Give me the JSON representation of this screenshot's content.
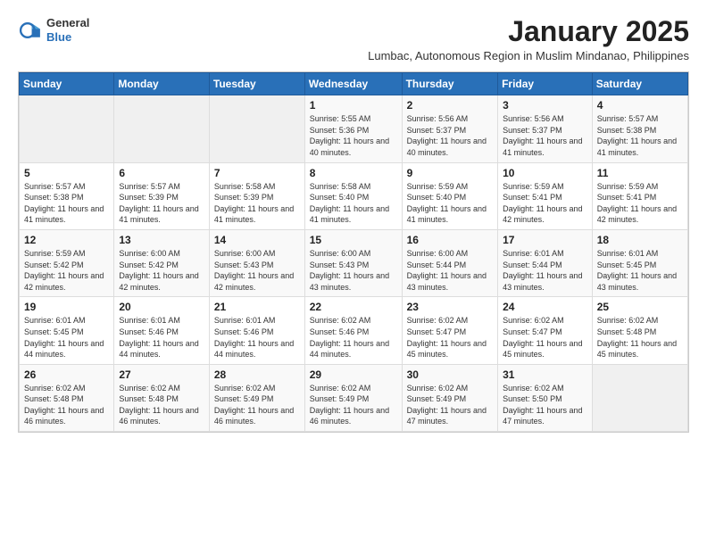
{
  "logo": {
    "line1": "General",
    "line2": "Blue"
  },
  "title": "January 2025",
  "subtitle": "Lumbac, Autonomous Region in Muslim Mindanao, Philippines",
  "weekdays": [
    "Sunday",
    "Monday",
    "Tuesday",
    "Wednesday",
    "Thursday",
    "Friday",
    "Saturday"
  ],
  "weeks": [
    [
      {
        "day": "",
        "content": ""
      },
      {
        "day": "",
        "content": ""
      },
      {
        "day": "",
        "content": ""
      },
      {
        "day": "1",
        "content": "Sunrise: 5:55 AM\nSunset: 5:36 PM\nDaylight: 11 hours and 40 minutes."
      },
      {
        "day": "2",
        "content": "Sunrise: 5:56 AM\nSunset: 5:37 PM\nDaylight: 11 hours and 40 minutes."
      },
      {
        "day": "3",
        "content": "Sunrise: 5:56 AM\nSunset: 5:37 PM\nDaylight: 11 hours and 41 minutes."
      },
      {
        "day": "4",
        "content": "Sunrise: 5:57 AM\nSunset: 5:38 PM\nDaylight: 11 hours and 41 minutes."
      }
    ],
    [
      {
        "day": "5",
        "content": "Sunrise: 5:57 AM\nSunset: 5:38 PM\nDaylight: 11 hours and 41 minutes."
      },
      {
        "day": "6",
        "content": "Sunrise: 5:57 AM\nSunset: 5:39 PM\nDaylight: 11 hours and 41 minutes."
      },
      {
        "day": "7",
        "content": "Sunrise: 5:58 AM\nSunset: 5:39 PM\nDaylight: 11 hours and 41 minutes."
      },
      {
        "day": "8",
        "content": "Sunrise: 5:58 AM\nSunset: 5:40 PM\nDaylight: 11 hours and 41 minutes."
      },
      {
        "day": "9",
        "content": "Sunrise: 5:59 AM\nSunset: 5:40 PM\nDaylight: 11 hours and 41 minutes."
      },
      {
        "day": "10",
        "content": "Sunrise: 5:59 AM\nSunset: 5:41 PM\nDaylight: 11 hours and 42 minutes."
      },
      {
        "day": "11",
        "content": "Sunrise: 5:59 AM\nSunset: 5:41 PM\nDaylight: 11 hours and 42 minutes."
      }
    ],
    [
      {
        "day": "12",
        "content": "Sunrise: 5:59 AM\nSunset: 5:42 PM\nDaylight: 11 hours and 42 minutes."
      },
      {
        "day": "13",
        "content": "Sunrise: 6:00 AM\nSunset: 5:42 PM\nDaylight: 11 hours and 42 minutes."
      },
      {
        "day": "14",
        "content": "Sunrise: 6:00 AM\nSunset: 5:43 PM\nDaylight: 11 hours and 42 minutes."
      },
      {
        "day": "15",
        "content": "Sunrise: 6:00 AM\nSunset: 5:43 PM\nDaylight: 11 hours and 43 minutes."
      },
      {
        "day": "16",
        "content": "Sunrise: 6:00 AM\nSunset: 5:44 PM\nDaylight: 11 hours and 43 minutes."
      },
      {
        "day": "17",
        "content": "Sunrise: 6:01 AM\nSunset: 5:44 PM\nDaylight: 11 hours and 43 minutes."
      },
      {
        "day": "18",
        "content": "Sunrise: 6:01 AM\nSunset: 5:45 PM\nDaylight: 11 hours and 43 minutes."
      }
    ],
    [
      {
        "day": "19",
        "content": "Sunrise: 6:01 AM\nSunset: 5:45 PM\nDaylight: 11 hours and 44 minutes."
      },
      {
        "day": "20",
        "content": "Sunrise: 6:01 AM\nSunset: 5:46 PM\nDaylight: 11 hours and 44 minutes."
      },
      {
        "day": "21",
        "content": "Sunrise: 6:01 AM\nSunset: 5:46 PM\nDaylight: 11 hours and 44 minutes."
      },
      {
        "day": "22",
        "content": "Sunrise: 6:02 AM\nSunset: 5:46 PM\nDaylight: 11 hours and 44 minutes."
      },
      {
        "day": "23",
        "content": "Sunrise: 6:02 AM\nSunset: 5:47 PM\nDaylight: 11 hours and 45 minutes."
      },
      {
        "day": "24",
        "content": "Sunrise: 6:02 AM\nSunset: 5:47 PM\nDaylight: 11 hours and 45 minutes."
      },
      {
        "day": "25",
        "content": "Sunrise: 6:02 AM\nSunset: 5:48 PM\nDaylight: 11 hours and 45 minutes."
      }
    ],
    [
      {
        "day": "26",
        "content": "Sunrise: 6:02 AM\nSunset: 5:48 PM\nDaylight: 11 hours and 46 minutes."
      },
      {
        "day": "27",
        "content": "Sunrise: 6:02 AM\nSunset: 5:48 PM\nDaylight: 11 hours and 46 minutes."
      },
      {
        "day": "28",
        "content": "Sunrise: 6:02 AM\nSunset: 5:49 PM\nDaylight: 11 hours and 46 minutes."
      },
      {
        "day": "29",
        "content": "Sunrise: 6:02 AM\nSunset: 5:49 PM\nDaylight: 11 hours and 46 minutes."
      },
      {
        "day": "30",
        "content": "Sunrise: 6:02 AM\nSunset: 5:49 PM\nDaylight: 11 hours and 47 minutes."
      },
      {
        "day": "31",
        "content": "Sunrise: 6:02 AM\nSunset: 5:50 PM\nDaylight: 11 hours and 47 minutes."
      },
      {
        "day": "",
        "content": ""
      }
    ]
  ]
}
